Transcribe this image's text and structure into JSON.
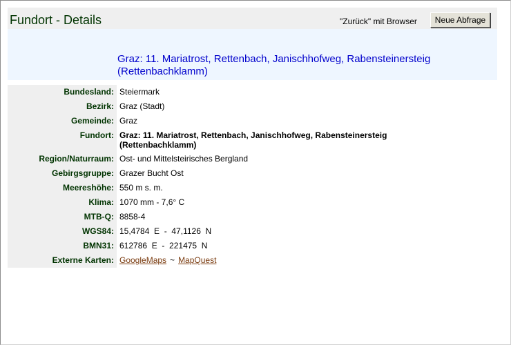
{
  "header": {
    "title": "Fundort - Details",
    "back_hint": "\"Zurück\" mit Browser",
    "new_query_label": "Neue Abfrage"
  },
  "location": {
    "heading": "Graz: 11. Mariatrost, Rettenbach, Janischhofweg, Rabensteinersteig (Rettenbachklamm)"
  },
  "details": [
    {
      "label": "Bundesland:",
      "value": "Steiermark"
    },
    {
      "label": "Bezirk:",
      "value": "Graz (Stadt)"
    },
    {
      "label": "Gemeinde:",
      "value": "Graz"
    },
    {
      "label": "Fundort:",
      "value": "Graz: 11. Mariatrost, Rettenbach, Janischhofweg, Rabensteinersteig (Rettenbachklamm)"
    },
    {
      "label": "Region/Naturraum:",
      "value": "Ost- und Mittelsteirisches Bergland"
    },
    {
      "label": "Gebirgsgruppe:",
      "value": "Grazer Bucht Ost"
    },
    {
      "label": "Meereshöhe:",
      "value": "550 m s. m."
    },
    {
      "label": "Klima:",
      "value": "1070 mm - 7,6° C"
    },
    {
      "label": "MTB-Q:",
      "value": "8858-4"
    },
    {
      "label": "WGS84:",
      "value": "15,4784  E  -  47,1126  N"
    },
    {
      "label": "BMN31:",
      "value": "612786  E  -  221475  N"
    },
    {
      "label": "Externe Karten:",
      "links": [
        "GoogleMaps",
        "MapQuest"
      ],
      "separator": "~"
    }
  ]
}
